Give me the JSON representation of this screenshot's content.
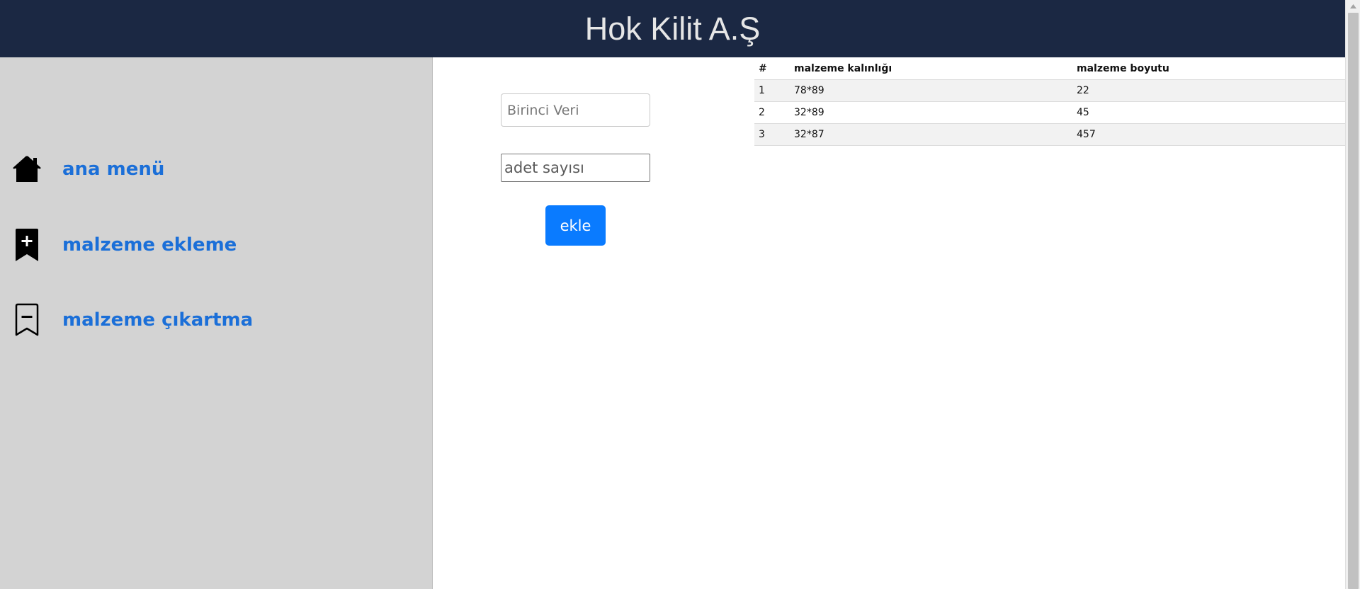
{
  "header": {
    "title": "Hok Kilit A.Ş"
  },
  "sidebar": {
    "items": [
      {
        "label": "ana menü",
        "icon": "house-icon"
      },
      {
        "label": "malzeme ekleme",
        "icon": "bookmark-plus-icon"
      },
      {
        "label": "malzeme çıkartma",
        "icon": "bookmark-dash-icon"
      }
    ]
  },
  "form": {
    "first_input_placeholder": "Birinci Veri",
    "second_input_placeholder": "adet sayısı",
    "submit_label": "ekle"
  },
  "table": {
    "headers": [
      "#",
      "malzeme kalınlığı",
      "malzeme boyutu"
    ],
    "rows": [
      [
        "1",
        "78*89",
        "22"
      ],
      [
        "2",
        "32*89",
        "45"
      ],
      [
        "3",
        "32*87",
        "457"
      ]
    ]
  },
  "colors": {
    "header_bg": "#1b2843",
    "sidebar_bg": "#d3d3d3",
    "link": "#1b6fd8",
    "button": "#0a7bff"
  }
}
